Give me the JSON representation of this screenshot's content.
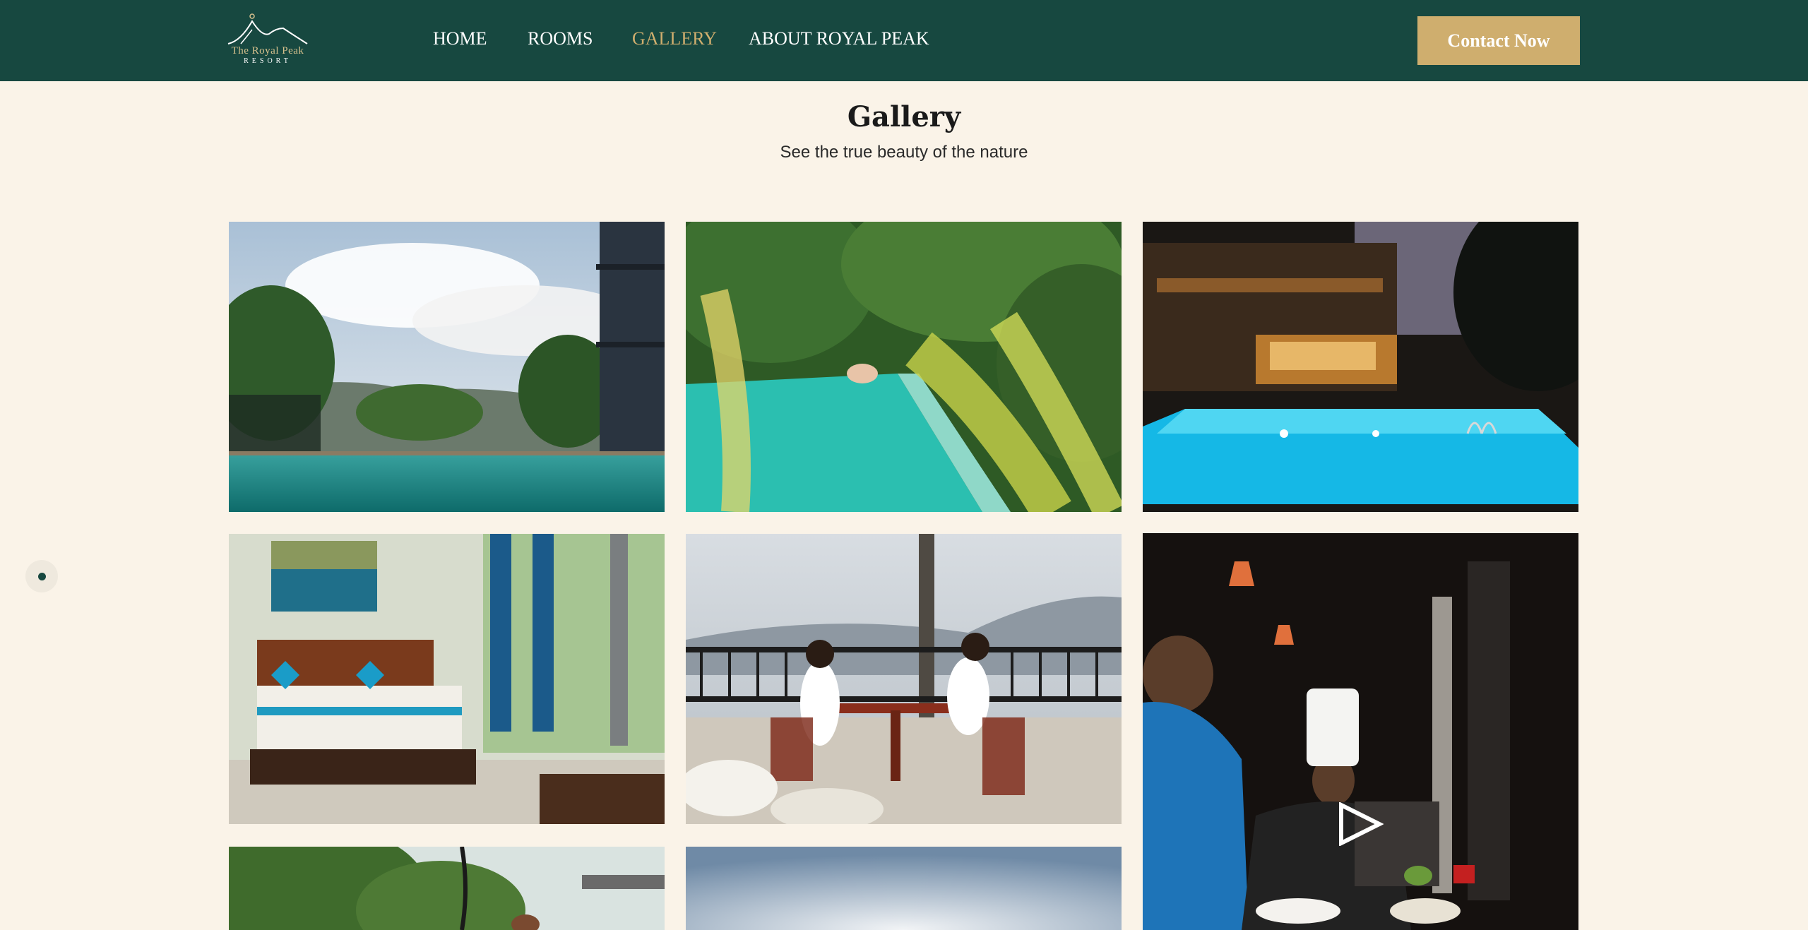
{
  "brand": {
    "logo_line1": "The Royal Peak",
    "logo_line2": "RESORT"
  },
  "nav": {
    "items": [
      {
        "label": "HOME",
        "active": false
      },
      {
        "label": "ROOMS",
        "active": false
      },
      {
        "label": "GALLERY",
        "active": true
      },
      {
        "label": "ABOUT ROYAL PEAK",
        "active": false
      }
    ],
    "contact_label": "Contact Now"
  },
  "page": {
    "title": "Gallery",
    "subtitle": "See the true beauty of the nature"
  },
  "gallery": {
    "items": [
      {
        "kind": "photo",
        "subject": "infinity-pool-mountain-view"
      },
      {
        "kind": "photo",
        "subject": "pool-jungle-swimmer"
      },
      {
        "kind": "photo",
        "subject": "pool-night-lights"
      },
      {
        "kind": "photo",
        "subject": "bedroom-blue-curtains"
      },
      {
        "kind": "photo",
        "subject": "couple-breakfast-balcony"
      },
      {
        "kind": "video",
        "subject": "chef-cooking-night"
      },
      {
        "kind": "photo",
        "subject": "garden-terrace"
      },
      {
        "kind": "photo",
        "subject": "misty-sky"
      }
    ]
  },
  "colors": {
    "navbar": "#174840",
    "accent_gold": "#cfae6e",
    "background": "#faf3e8"
  },
  "icons": [
    "mountain-logo-icon",
    "scroll-indicator-icon",
    "play-icon"
  ]
}
